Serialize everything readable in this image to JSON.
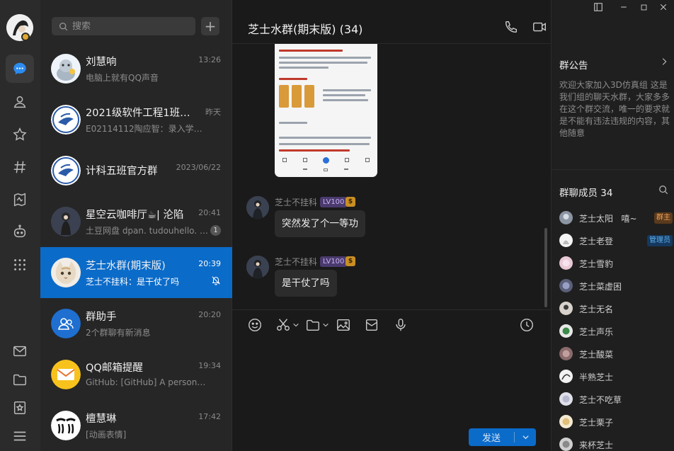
{
  "window": {
    "title": "芝士水群(期末版) (34)"
  },
  "search": {
    "placeholder": "搜索"
  },
  "conversations": [
    {
      "name": "刘慧响",
      "time": "13:26",
      "preview": "电脑上就有QQ声音"
    },
    {
      "name": "2021级软件工程1班通知群",
      "time": "昨天",
      "preview": "E02114112陶应智：录入学校门户"
    },
    {
      "name": "计科五班官方群",
      "time": "2023/06/22",
      "preview": ""
    },
    {
      "name": "星空云咖啡厅☕| 沦陷",
      "time": "20:41",
      "preview": "土豆网盘 dpan. tudouhello. com",
      "badge": "1"
    },
    {
      "name": "芝士水群(期末版)",
      "time": "20:39",
      "preview": "芝士不挂科：是干仗了吗",
      "active": true
    },
    {
      "name": "群助手",
      "time": "20:20",
      "preview": "2个群聊有新消息"
    },
    {
      "name": "QQ邮箱提醒",
      "time": "19:34",
      "preview": "GitHub: [GitHub] A personal access"
    },
    {
      "name": "檀慧琳",
      "time": "17:42",
      "preview": "[动画表情]"
    }
  ],
  "messages": [
    {
      "sender": "芝士不挂科",
      "level": "LV100",
      "coin": "$",
      "text": "突然发了个一等功"
    },
    {
      "sender": "芝士不挂科",
      "level": "LV100",
      "coin": "$",
      "text": "是干仗了吗"
    }
  ],
  "compose": {
    "send_label": "发送"
  },
  "announcement": {
    "title": "群公告",
    "text": "欢迎大家加入3D仿真组 这是我们组的聊天水群，大家多多在这个群交流，唯一的要求就是不能有违法违规的内容，其他随意"
  },
  "members": {
    "title": "群聊成员 34",
    "list": [
      {
        "name": "芝士太阳",
        "extra": "嘻~",
        "role": "群主"
      },
      {
        "name": "芝士老登",
        "role": "管理员"
      },
      {
        "name": "芝士雪豹"
      },
      {
        "name": "芝士菜虚困"
      },
      {
        "name": "芝士无名"
      },
      {
        "name": "芝士声乐"
      },
      {
        "name": "芝士酸菜"
      },
      {
        "name": "半熟芝士"
      },
      {
        "name": "芝士不吃草"
      },
      {
        "name": "芝士栗子"
      },
      {
        "name": "来杯芝士"
      }
    ]
  },
  "colors": {
    "accent": "#0b6bc9",
    "owner_tag": "#f0a25c",
    "admin_tag": "#5fb0ef",
    "level_tag": "#c9b6f0"
  }
}
